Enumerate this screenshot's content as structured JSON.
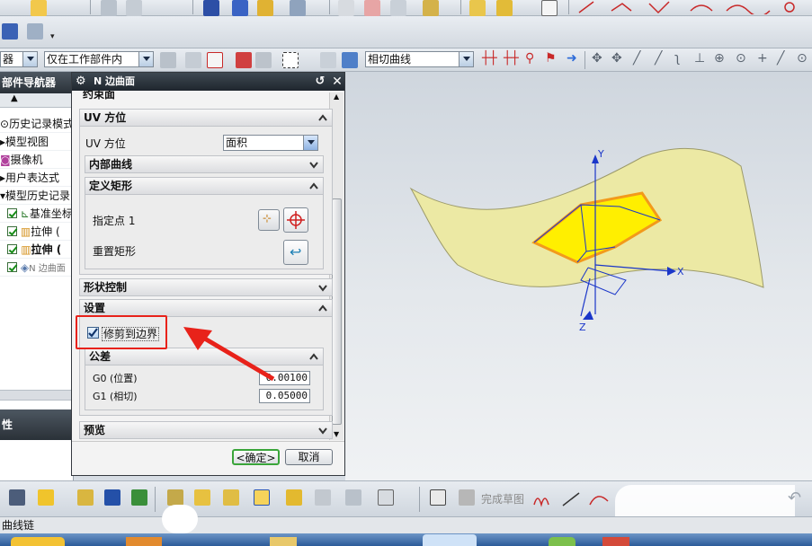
{
  "toolbar_filter": {
    "select_label": "器",
    "scope_value": "仅在工作部件内",
    "curve_rule_value": "相切曲线"
  },
  "navigator": {
    "title": "部件导航器",
    "items": [
      {
        "label": "历史记录模式"
      },
      {
        "label": "模型视图"
      },
      {
        "label": "摄像机"
      },
      {
        "label": "用户表达式"
      },
      {
        "label": "模型历史记录"
      },
      {
        "label": "基准坐标"
      },
      {
        "label": "拉伸 ("
      },
      {
        "label": "拉伸 ("
      },
      {
        "label": "N 边曲面"
      }
    ],
    "bottom_label": "性"
  },
  "dialog": {
    "title": "N 边曲面",
    "truncated_section": "约束面",
    "uv_section": {
      "title": "UV 方位",
      "uv_label": "UV 方位",
      "uv_value": "面积",
      "inner_curves_title": "内部曲线",
      "define_rect_title": "定义矩形",
      "specify_point_label": "指定点 1",
      "reset_rect_label": "重置矩形"
    },
    "shape_control_title": "形状控制",
    "settings": {
      "title": "设置",
      "trim_to_boundary_label": "修剪到边界",
      "trim_to_boundary_checked": true,
      "tolerance_title": "公差",
      "g0_label": "G0 (位置)",
      "g0_value": "0.00100",
      "g1_label": "G1 (相切)",
      "g1_value": "0.05000"
    },
    "preview_title": "预览",
    "ok_label": "<确定>",
    "cancel_label": "取消"
  },
  "viewport": {
    "axis_labels": {
      "x": "X",
      "y": "Y",
      "z": "Z"
    }
  },
  "bottom_toolbar": {
    "finish_sketch_label": "完成草图"
  },
  "status_bar": {
    "text": "曲线链"
  },
  "colors": {
    "surface_fill": "#ece9a4",
    "patch_fill": "#ffef00",
    "patch_edge": "#f29a1b",
    "axis": "#1a36c9",
    "annotation": "#e8221a"
  }
}
